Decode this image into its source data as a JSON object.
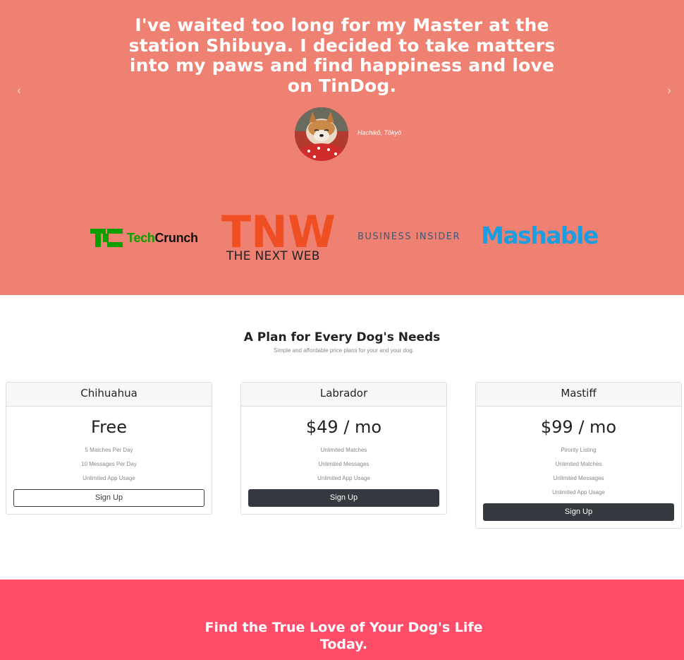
{
  "testimonial": {
    "quote": "I've waited too long for my Master at the station Shibuya. I decided to take matters into my paws and find happiness and love on TinDog.",
    "author": "Hachikō, Tōkyō",
    "prev_arrow": "‹",
    "next_arrow": "›"
  },
  "press": {
    "techcrunch": {
      "tech": "Tech",
      "crunch": "Crunch"
    },
    "tnw": {
      "mark": "TNW",
      "tagline": "THE NEXT WEB"
    },
    "business_insider": "BUSINESS INSIDER",
    "mashable": "Mashable"
  },
  "pricing": {
    "title": "A Plan for Every Dog's Needs",
    "subtitle": "Simple and affordable price plans for your and your dog.",
    "plans": [
      {
        "name": "Chihuahua",
        "price": "Free",
        "features": [
          "5 Matches Per Day",
          "10 Messages Per Day",
          "Unlimited App Usage"
        ],
        "button": "Sign Up"
      },
      {
        "name": "Labrador",
        "price": "$49 / mo",
        "features": [
          "Unlimited Matches",
          "Unlimited Messages",
          "Unlimited App Usage"
        ],
        "button": "Sign Up"
      },
      {
        "name": "Mastiff",
        "price": "$99 / mo",
        "features": [
          "Pirority Listing",
          "Unlimited Matches",
          "Unlimited Messages",
          "Unlimited App Usage"
        ],
        "button": "Sign Up"
      }
    ]
  },
  "cta": {
    "title": "Find the True Love of Your Dog's Life Today."
  },
  "colors": {
    "testimonial_bg": "#ef8172",
    "cta_bg": "#ff4c68",
    "button_dark": "#343a40",
    "techcrunch_green": "#0a9e01",
    "tnw_orange": "#f04e23",
    "mashable_blue": "#1c9de0"
  }
}
